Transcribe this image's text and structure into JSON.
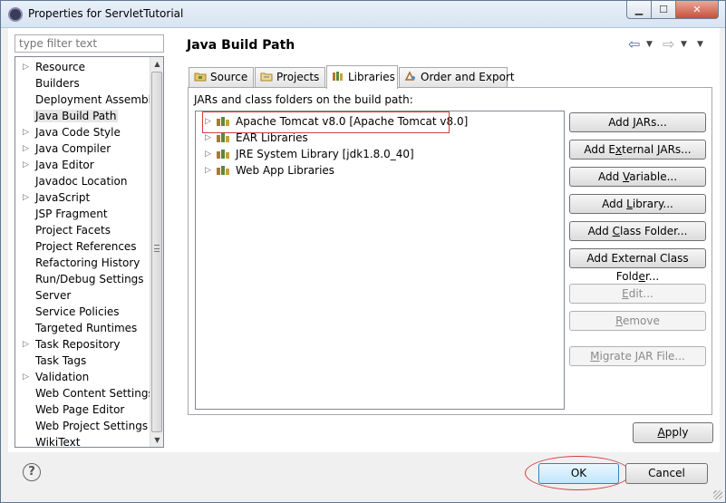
{
  "window": {
    "title": "Properties for ServletTutorial",
    "min_glyph": "▁",
    "max_glyph": "☐",
    "close_glyph": "✕"
  },
  "filter": {
    "placeholder": "type filter text"
  },
  "tree": {
    "items": [
      {
        "label": "Resource",
        "expandable": true
      },
      {
        "label": "Builders",
        "expandable": false
      },
      {
        "label": "Deployment Assembly",
        "expandable": false
      },
      {
        "label": "Java Build Path",
        "expandable": false,
        "selected": true
      },
      {
        "label": "Java Code Style",
        "expandable": true
      },
      {
        "label": "Java Compiler",
        "expandable": true
      },
      {
        "label": "Java Editor",
        "expandable": true
      },
      {
        "label": "Javadoc Location",
        "expandable": false
      },
      {
        "label": "JavaScript",
        "expandable": true
      },
      {
        "label": "JSP Fragment",
        "expandable": false
      },
      {
        "label": "Project Facets",
        "expandable": false
      },
      {
        "label": "Project References",
        "expandable": false
      },
      {
        "label": "Refactoring History",
        "expandable": false
      },
      {
        "label": "Run/Debug Settings",
        "expandable": false
      },
      {
        "label": "Server",
        "expandable": false
      },
      {
        "label": "Service Policies",
        "expandable": false
      },
      {
        "label": "Targeted Runtimes",
        "expandable": false
      },
      {
        "label": "Task Repository",
        "expandable": true
      },
      {
        "label": "Task Tags",
        "expandable": false
      },
      {
        "label": "Validation",
        "expandable": true
      },
      {
        "label": "Web Content Settings",
        "expandable": false
      },
      {
        "label": "Web Page Editor",
        "expandable": false
      },
      {
        "label": "Web Project Settings",
        "expandable": false
      },
      {
        "label": "WikiText",
        "expandable": false
      }
    ]
  },
  "page": {
    "title": "Java Build Path"
  },
  "nav": {
    "back": "⇦",
    "forward": "⇨",
    "dropdown": "▼"
  },
  "tabs": [
    {
      "label": "Source",
      "active": false
    },
    {
      "label": "Projects",
      "active": false
    },
    {
      "label": "Libraries",
      "active": true
    },
    {
      "label": "Order and Export",
      "active": false
    }
  ],
  "libraries": {
    "heading": "JARs and class folders on the build path:",
    "entries": [
      {
        "label": "Apache Tomcat v8.0 [Apache Tomcat v8.0]",
        "highlighted": true
      },
      {
        "label": "EAR Libraries",
        "highlighted": false
      },
      {
        "label": "JRE System Library [jdk1.8.0_40]",
        "highlighted": false
      },
      {
        "label": "Web App Libraries",
        "highlighted": false
      }
    ]
  },
  "side_buttons": {
    "add_jars": {
      "pre": "Add ",
      "mn": "J",
      "post": "ARs..."
    },
    "add_external_jars": {
      "pre": "Add E",
      "mn": "x",
      "post": "ternal JARs..."
    },
    "add_variable": {
      "pre": "Add ",
      "mn": "V",
      "post": "ariable..."
    },
    "add_library": {
      "pre": "Add ",
      "mn": "L",
      "post": "ibrary..."
    },
    "add_class_folder": {
      "pre": "Add ",
      "mn": "C",
      "post": "lass Folder..."
    },
    "add_external_class_folder": {
      "pre": "Add External Class Fold",
      "mn": "e",
      "post": "r..."
    },
    "edit": {
      "pre": "",
      "mn": "E",
      "post": "dit..."
    },
    "remove": {
      "pre": "",
      "mn": "R",
      "post": "emove"
    },
    "migrate": {
      "pre": "",
      "mn": "M",
      "post": "igrate JAR File..."
    }
  },
  "footer": {
    "apply": {
      "pre": "",
      "mn": "A",
      "post": "pply"
    },
    "help_glyph": "?",
    "ok": "OK",
    "cancel": "Cancel"
  },
  "colors": {
    "annotation": "#d04040",
    "selection": "#e6e6e6"
  }
}
